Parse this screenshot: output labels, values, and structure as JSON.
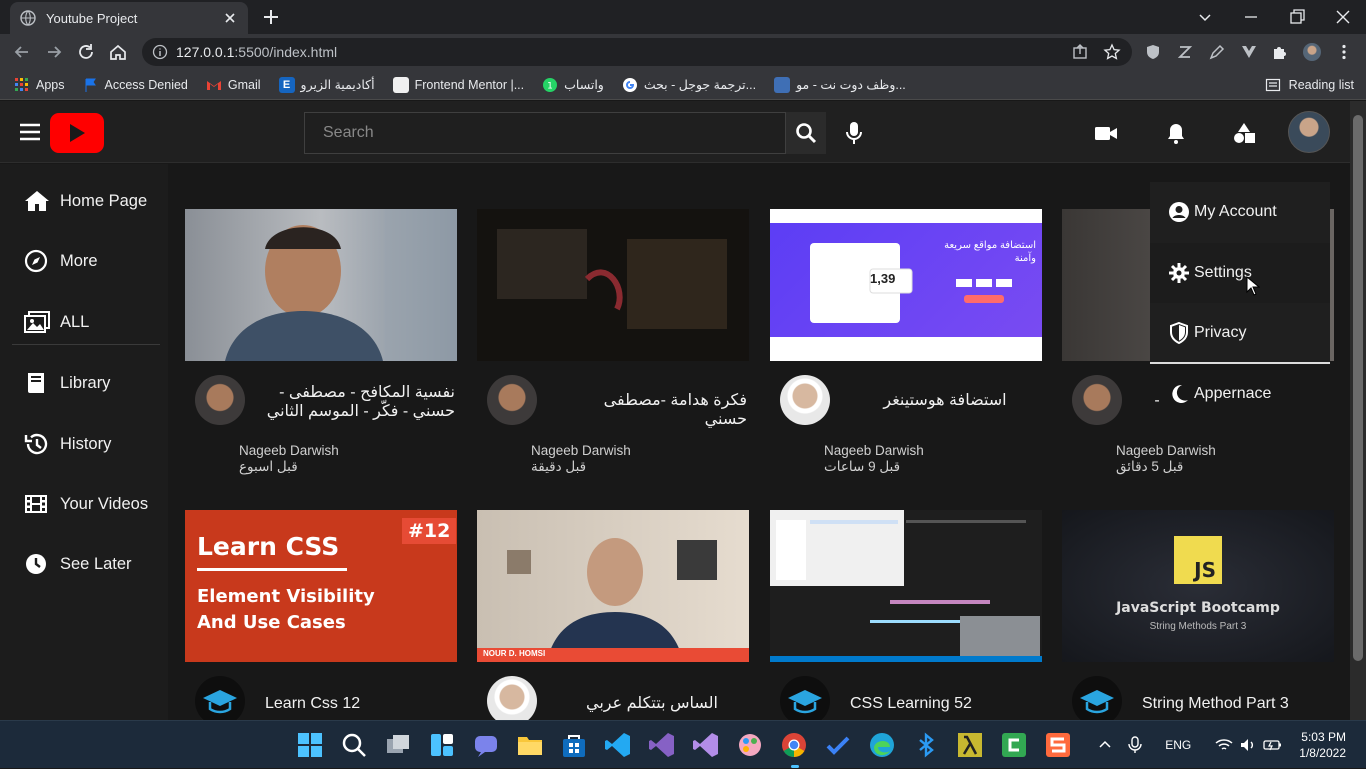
{
  "browser": {
    "tab_title": "Youtube Project",
    "url_host": "127.0.0.1",
    "url_rest": ":5500/index.html",
    "bookmarks": [
      {
        "label": "Apps",
        "color": "#ea4335"
      },
      {
        "label": "Access Denied",
        "color": "#1a73e8"
      },
      {
        "label": "Gmail",
        "color": "#ea4335"
      },
      {
        "label": "أكاديمية الزيرو",
        "color": "#1565c0"
      },
      {
        "label": "Frontend Mentor |...",
        "color": "#f0f0f0"
      },
      {
        "label": "واتساب",
        "color": "#25d366"
      },
      {
        "label": "ترجمة جوجل - بحث...",
        "color": "#4285f4"
      },
      {
        "label": "وظف دوت نت - مو...",
        "color": "#3f6fb5"
      }
    ],
    "reading_list": "Reading list"
  },
  "header": {
    "search_placeholder": "Search"
  },
  "sidebar": {
    "items": [
      {
        "label": "Home Page",
        "icon": "home-icon"
      },
      {
        "label": "More",
        "icon": "compass-icon"
      },
      {
        "label": "ALL",
        "icon": "images-icon"
      },
      {
        "label": "Library",
        "icon": "book-icon"
      },
      {
        "label": "History",
        "icon": "history-icon"
      },
      {
        "label": "Your Videos",
        "icon": "film-icon"
      },
      {
        "label": "See Later",
        "icon": "clock-icon"
      }
    ]
  },
  "videos": [
    {
      "title_line1": "نفسية المكافح - مصطفى -",
      "title_line2": "حسني - فكّر - الموسم الثاني",
      "channel": "Nageeb Darwish",
      "time": "قبل اسبوع"
    },
    {
      "title_line1": "فكرة هدامة -مصطفى حسني",
      "title_line2": "",
      "channel": "Nageeb Darwish",
      "time": "قبل دقيقة"
    },
    {
      "title_line1": "استضافة هوستينغر",
      "title_line2": "",
      "channel": "Nageeb Darwish",
      "time": "قبل 9 ساعات"
    },
    {
      "title_line1": "-",
      "title_line2": "",
      "channel": "Nageeb Darwish",
      "time": "قبل 5 دقائق"
    },
    {
      "title_line1": "Learn Css 12",
      "title_line2": "",
      "channel": "",
      "time": ""
    },
    {
      "title_line1": "الساس بتتكلم عربي",
      "title_line2": "",
      "channel": "",
      "time": ""
    },
    {
      "title_line1": "CSS Learning 52",
      "title_line2": "",
      "channel": "",
      "time": ""
    },
    {
      "title_line1": "String Method Part 3",
      "title_line2": "",
      "channel": "",
      "time": ""
    }
  ],
  "thumbs": {
    "learn_css_title": "Learn CSS",
    "learn_css_badge": "#12",
    "learn_css_sub1": "Element Visibility",
    "learn_css_sub2": "And Use Cases",
    "hostinger_heading": "استضافة مواقع سريعة وآمنة",
    "hostinger_price": "1,39",
    "js_badge": "JS",
    "js_title": "JavaScript Bootcamp",
    "js_sub": "String Methods Part 3",
    "nour_name": "NOUR D. HOMSI"
  },
  "dropdown": {
    "items": [
      {
        "label": "My Account",
        "icon": "user-circle-icon"
      },
      {
        "label": "Settings",
        "icon": "gear-icon"
      },
      {
        "label": "Privacy",
        "icon": "shield-icon"
      }
    ],
    "appearance": "Appernace"
  },
  "taskbar": {
    "lang": "ENG",
    "time": "5:03 PM",
    "date": "1/8/2022"
  },
  "colors": {
    "brand_red": "#ff0000",
    "background": "#181818",
    "header": "#202020"
  }
}
